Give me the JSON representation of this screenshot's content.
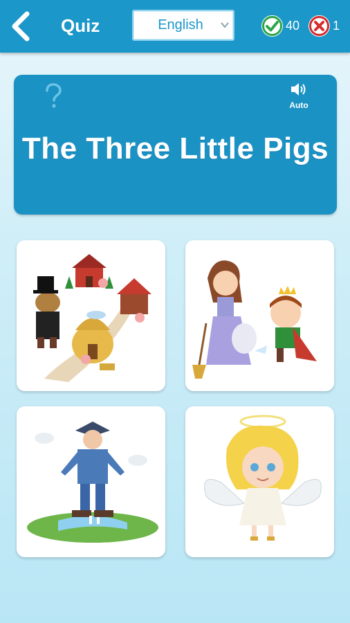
{
  "header": {
    "title": "Quiz",
    "language_selected": "English",
    "correct_count": "40",
    "wrong_count": "1"
  },
  "icons": {
    "back": "chevron-left-icon",
    "dropdown": "chevron-down-icon",
    "correct": "checkmark-icon",
    "wrong": "close-icon",
    "hint": "question-mark-icon",
    "audio": "speaker-icon"
  },
  "question": {
    "text": "The Three Little Pigs",
    "audio_label": "Auto"
  },
  "options": [
    {
      "illustration": "three-little-pigs-illustration"
    },
    {
      "illustration": "cinderella-illustration"
    },
    {
      "illustration": "gulliver-giant-illustration"
    },
    {
      "illustration": "angel-illustration"
    }
  ],
  "colors": {
    "header_bg": "#1b97c9",
    "card_bg": "#1b92c4",
    "correct_green": "#2aa64a",
    "wrong_red": "#d62b2b"
  }
}
